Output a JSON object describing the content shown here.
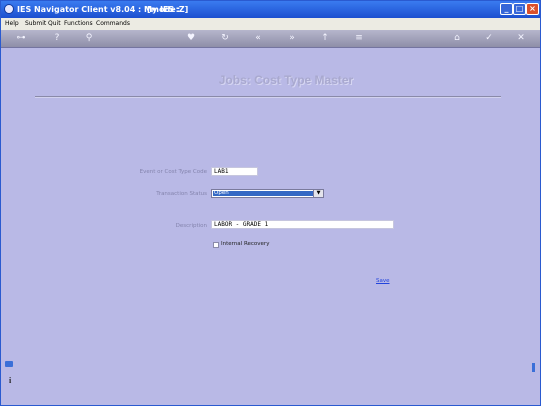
{
  "window": {
    "title": "IES Navigator Client v8.04 : My IES :",
    "mode": "[mode:Z]",
    "minimize": "_",
    "maximize": "□",
    "close": "×"
  },
  "menu": [
    "Help",
    "Submit",
    "Quit",
    "Functions",
    "Commands"
  ],
  "toolbar": {
    "icons": [
      "key-icon",
      "help-icon",
      "search-icon",
      "heart-icon",
      "refresh-icon",
      "back-icon",
      "forward-icon",
      "up-icon",
      "list-icon",
      "home-icon",
      "ok-icon",
      "cancel-icon"
    ],
    "glyphs": [
      "⊶",
      "?",
      "⚲",
      "♥",
      "↻",
      "«",
      "»",
      "↑",
      "≡",
      "⌂",
      "✓",
      "✕"
    ]
  },
  "form": {
    "title": "Jobs: Cost Type Master",
    "code_label": "Event or Cost Type Code",
    "code_value": "LAB1",
    "status_label": "Transaction Status",
    "status_value": "Open",
    "description_label": "Description",
    "description_value": "LABOR - GRADE 1",
    "internal_recovery_label": "Internal Recovery",
    "internal_recovery_checked": false,
    "save_label": "Save"
  },
  "sidebar": {
    "bottom_letter": "i"
  },
  "colors": {
    "background": "#b9b9e6",
    "titlebar": "#1c4fcf",
    "selection": "#3468c4",
    "link": "#2244dd"
  }
}
